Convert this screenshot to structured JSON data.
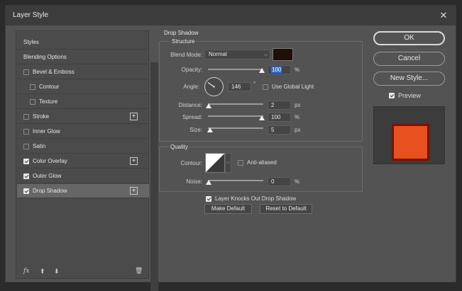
{
  "window": {
    "title": "Layer Style",
    "close_glyph": "✕"
  },
  "left_panel": {
    "items": [
      {
        "label": "Styles",
        "checkbox": false,
        "checked": false,
        "plus": false,
        "selected": false
      },
      {
        "label": "Blending Options",
        "checkbox": false,
        "checked": false,
        "plus": false,
        "selected": false
      },
      {
        "label": "Bevel & Emboss",
        "checkbox": true,
        "checked": false,
        "plus": false,
        "selected": false
      },
      {
        "label": "Contour",
        "checkbox": true,
        "checked": false,
        "plus": false,
        "selected": false,
        "indent": true
      },
      {
        "label": "Texture",
        "checkbox": true,
        "checked": false,
        "plus": false,
        "selected": false,
        "indent": true
      },
      {
        "label": "Stroke",
        "checkbox": true,
        "checked": false,
        "plus": true,
        "selected": false
      },
      {
        "label": "Inner Glow",
        "checkbox": true,
        "checked": false,
        "plus": false,
        "selected": false
      },
      {
        "label": "Satin",
        "checkbox": true,
        "checked": false,
        "plus": false,
        "selected": false
      },
      {
        "label": "Color Overlay",
        "checkbox": true,
        "checked": true,
        "plus": true,
        "selected": false
      },
      {
        "label": "Outer Glow",
        "checkbox": true,
        "checked": true,
        "plus": false,
        "selected": false
      },
      {
        "label": "Drop Shadow",
        "checkbox": true,
        "checked": true,
        "plus": true,
        "selected": true
      }
    ],
    "footer": {
      "fx": "fx",
      "up": "⬆",
      "down": "⬇",
      "trash": "🗑"
    }
  },
  "drop_shadow": {
    "section_title": "Drop Shadow",
    "structure": {
      "title": "Structure",
      "blend_mode_label": "Blend Mode:",
      "blend_mode_value": "Normal",
      "shadow_color": "#1e0f08",
      "opacity_label": "Opacity:",
      "opacity_value": "100",
      "opacity_unit": "%",
      "opacity_fraction": 1.0,
      "angle_label": "Angle:",
      "angle_value": "146",
      "angle_unit": "°",
      "use_global_light_label": "Use Global Light",
      "use_global_light_checked": false,
      "distance_label": "Distance:",
      "distance_value": "2",
      "distance_unit": "px",
      "spread_label": "Spread:",
      "spread_value": "100",
      "spread_unit": "%",
      "size_label": "Size:",
      "size_value": "5",
      "size_unit": "px"
    },
    "quality": {
      "title": "Quality",
      "contour_label": "Contour:",
      "anti_aliased_label": "Anti-aliased",
      "anti_aliased_checked": false,
      "noise_label": "Noise:",
      "noise_value": "0",
      "noise_unit": "%"
    },
    "knockout_label": "Layer Knocks Out Drop Shadow",
    "knockout_checked": true,
    "make_default_label": "Make Default",
    "reset_default_label": "Reset to Default"
  },
  "right_panel": {
    "ok_label": "OK",
    "cancel_label": "Cancel",
    "new_style_label": "New Style...",
    "preview_label": "Preview",
    "preview_checked": true,
    "preview_fill": "#e8501f",
    "preview_border": "#7e1000"
  }
}
